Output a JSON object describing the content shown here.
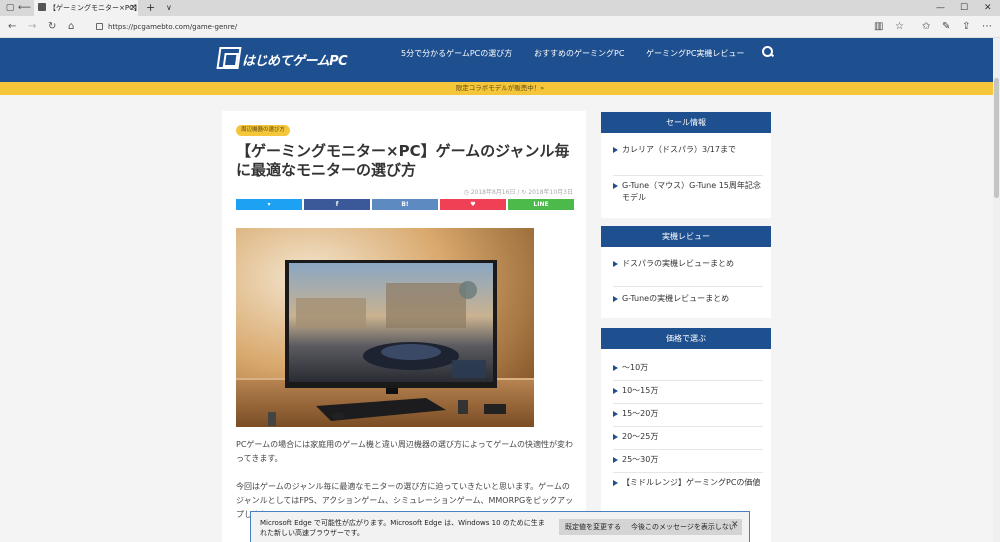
{
  "browser": {
    "tab_title": "【ゲーミングモニター×PC】ゲ",
    "tab_close": "✕",
    "new_tab": "+",
    "tab_menu": "∨",
    "url": "https://pcgamebto.com/game-genre/",
    "win_min": "—",
    "win_max": "☐",
    "win_close": "✕"
  },
  "header": {
    "logo_text": "はじめてゲームPC",
    "nav": [
      "5分で分かるゲームPCの選び方",
      "おすすめのゲーミングPC",
      "ゲーミングPC実機レビュー"
    ]
  },
  "banner": "限定コラボモデルが販売中！»",
  "article": {
    "category": "周辺機器の選び方",
    "title": "【ゲーミングモニター×PC】ゲームのジャンル毎に最適なモニターの選び方",
    "date_published": "2018年8月16日",
    "date_updated": "2018年10月3日",
    "share": {
      "twitter": "",
      "facebook": "f",
      "hatena": "B!",
      "pocket": "",
      "line": "LINE"
    },
    "paragraph_1": "PCゲームの場合には家庭用のゲーム機と違い周辺機器の選び方によってゲームの快適性が変わってきます。",
    "paragraph_2": "今回はゲームのジャンル毎に最適なモニターの選び方に迫っていきたいと思います。ゲームのジャンルとしてはFPS、アクションゲーム、シミュレーションゲーム、MMORPGをピックアップしまし"
  },
  "sidebar": {
    "sale": {
      "heading": "セール情報",
      "items": [
        "カレリア（ドスパラ）3/17まで",
        "G-Tune（マウス）G-Tune 15周年記念モデル"
      ]
    },
    "review": {
      "heading": "実機レビュー",
      "items": [
        "ドスパラの実機レビューまとめ",
        "G-Tuneの実機レビューまとめ"
      ]
    },
    "price": {
      "heading": "価格で選ぶ",
      "items": [
        "～10万",
        "10～15万",
        "15～20万",
        "20～25万",
        "25～30万",
        "【ミドルレンジ】ゲーミングPCの価値"
      ]
    }
  },
  "notification": {
    "message": "Microsoft Edge で可能性が広がります。Microsoft Edge は、Windows 10 のために生まれた新しい高速ブラウザーです。",
    "btn_default": "既定値を変更する",
    "btn_dismiss": "今後このメッセージを表示しない",
    "close": "✕"
  },
  "colors": {
    "header_blue": "#1e4f8f",
    "banner_yellow": "#f5c53a",
    "twitter": "#1da1f2",
    "facebook": "#3b5998",
    "hatena": "#5d8ac1",
    "pocket": "#ef4056",
    "line": "#4cb94b"
  }
}
